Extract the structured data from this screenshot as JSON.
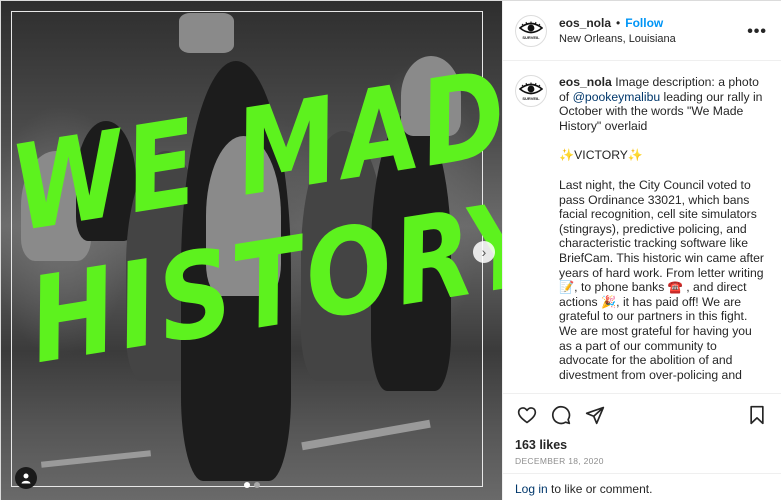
{
  "post": {
    "username": "eos_nola",
    "follow_label": "Follow",
    "separator": "•",
    "location": "New Orleans, Louisiana",
    "more_label": "•••",
    "avatar_caption": "SURVEIL",
    "overlay_line1": "WE MADE",
    "overlay_line2": "HISTORY",
    "caption": {
      "username": "eos_nola",
      "intro_before_mention": "Image description: a photo of ",
      "mention": "@pookeymalibu",
      "intro_after_mention": " leading our rally in October with the words \"We Made History\" overlaid",
      "victory": "✨VICTORY✨",
      "body": "Last night, the City Council voted to pass Ordinance 33021, which bans facial recognition, cell site simulators (stingrays), predictive policing, and characteristic tracking software like BriefCam. This historic win came after years of hard work. From letter writing 📝, to phone banks ☎️ , and direct actions 🎉, it has paid off! We are grateful to our partners in this fight. We are most grateful for having you as a part of our community to advocate for the abolition of and divestment from over-policing and"
    },
    "likes": "163 likes",
    "date": "DECEMBER 18, 2020",
    "login_link": "Log in",
    "login_rest": " to like or comment."
  },
  "carousel": {
    "dots": 2,
    "active_index": 0
  },
  "icons": {
    "heart": "heart-icon",
    "comment": "comment-icon",
    "share": "share-icon",
    "save": "bookmark-icon",
    "next": "chevron-right-icon",
    "user_tag": "user-tag-icon"
  },
  "colors": {
    "follow": "#0095f6",
    "mention": "#00376b",
    "overlay_green": "#5df21e"
  }
}
